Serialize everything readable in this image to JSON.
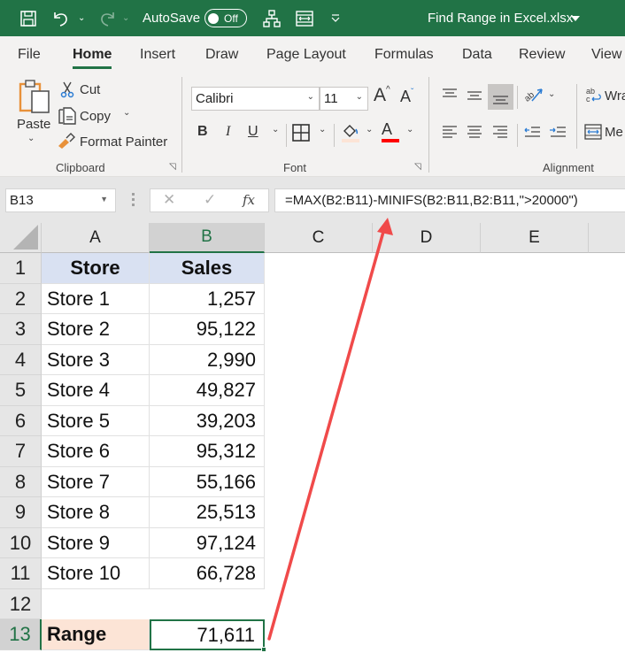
{
  "titlebar": {
    "autosave_label": "AutoSave",
    "autosave_state": "Off",
    "document_title": "Find Range in Excel.xlsx",
    "icons": [
      "save-icon",
      "undo-icon",
      "redo-icon",
      "org-chart-icon",
      "merge-center-icon",
      "customize-qat-icon"
    ]
  },
  "tabs": [
    {
      "label": "File",
      "active": false
    },
    {
      "label": "Home",
      "active": true
    },
    {
      "label": "Insert",
      "active": false
    },
    {
      "label": "Draw",
      "active": false
    },
    {
      "label": "Page Layout",
      "active": false
    },
    {
      "label": "Formulas",
      "active": false
    },
    {
      "label": "Data",
      "active": false
    },
    {
      "label": "Review",
      "active": false
    },
    {
      "label": "View",
      "active": false
    }
  ],
  "ribbon": {
    "clipboard": {
      "group_label": "Clipboard",
      "paste_label": "Paste",
      "cut_label": "Cut",
      "copy_label": "Copy",
      "format_painter_label": "Format Painter"
    },
    "font": {
      "group_label": "Font",
      "font_name": "Calibri",
      "font_size": "11",
      "bold_label": "B",
      "italic_label": "I",
      "underline_label": "U",
      "grow_label": "A",
      "shrink_label": "A",
      "font_color_label": "A",
      "font_color": "#ff0000",
      "fill_color": "#fce4d6"
    },
    "alignment": {
      "group_label": "Alignment",
      "wrap_label": "Wra",
      "merge_label": "Me"
    }
  },
  "formula_bar": {
    "name_box": "B13",
    "cancel_symbol": "✕",
    "enter_symbol": "✓",
    "fx_label": "fx",
    "formula": "=MAX(B2:B11)-MINIFS(B2:B11,B2:B11,\">20000\")"
  },
  "sheet": {
    "columns": [
      "A",
      "B",
      "C",
      "D",
      "E"
    ],
    "selected_column": "B",
    "rows": [
      "1",
      "2",
      "3",
      "4",
      "5",
      "6",
      "7",
      "8",
      "9",
      "10",
      "11",
      "12",
      "13"
    ],
    "selected_row": "13",
    "header": {
      "store": "Store",
      "sales": "Sales"
    },
    "data": [
      {
        "store": "Store 1",
        "sales": "1,257"
      },
      {
        "store": "Store 2",
        "sales": "95,122"
      },
      {
        "store": "Store 3",
        "sales": "2,990"
      },
      {
        "store": "Store 4",
        "sales": "49,827"
      },
      {
        "store": "Store 5",
        "sales": "39,203"
      },
      {
        "store": "Store 6",
        "sales": "95,312"
      },
      {
        "store": "Store 7",
        "sales": "55,166"
      },
      {
        "store": "Store 8",
        "sales": "25,513"
      },
      {
        "store": "Store 9",
        "sales": "97,124"
      },
      {
        "store": "Store 10",
        "sales": "66,728"
      }
    ],
    "result": {
      "label": "Range",
      "value": "71,611"
    },
    "colors": {
      "header_fill": "#d9e1f2",
      "result_label_fill": "#fce4d6",
      "selection": "#217346",
      "annotation_arrow": "#f04a4a"
    }
  },
  "annotation": {
    "type": "arrow",
    "from": "B13",
    "to": "formula-bar"
  }
}
